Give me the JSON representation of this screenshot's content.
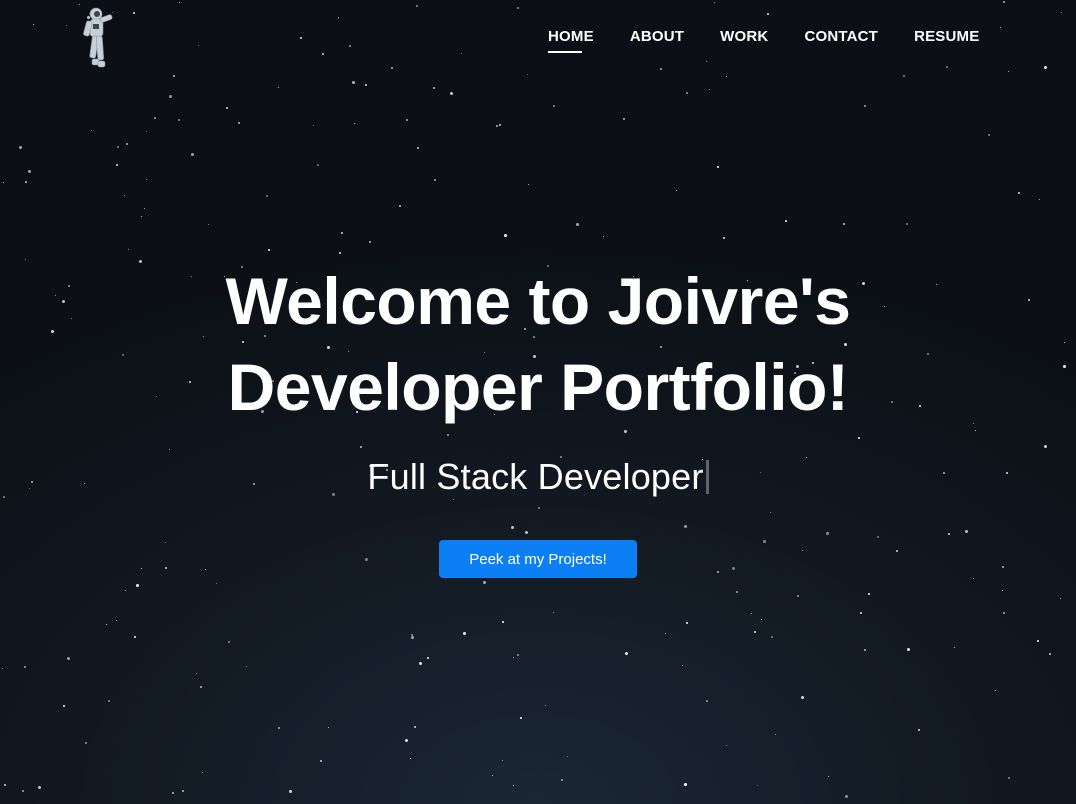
{
  "nav": {
    "items": [
      {
        "label": "HOME",
        "active": true
      },
      {
        "label": "ABOUT",
        "active": false
      },
      {
        "label": "WORK",
        "active": false
      },
      {
        "label": "CONTACT",
        "active": false
      },
      {
        "label": "RESUME",
        "active": false
      }
    ]
  },
  "logo": {
    "icon": "astronaut-icon"
  },
  "hero": {
    "title_line1": "Welcome to Joivre's",
    "title_line2": "Developer Portfolio!",
    "subtitle": "Full Stack Developer",
    "cta_label": "Peek at my Projects!"
  },
  "colors": {
    "background": "#111821",
    "accent": "#0d7ff5",
    "text": "#ffffff"
  }
}
